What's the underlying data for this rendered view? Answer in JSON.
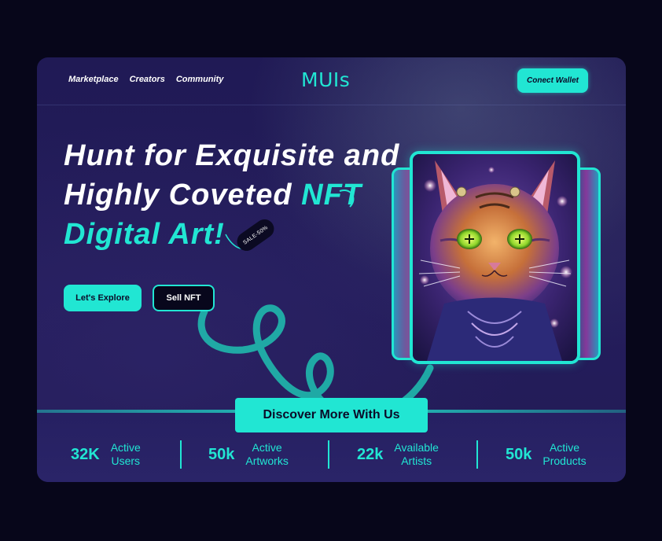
{
  "nav": {
    "links": [
      "Marketplace",
      "Creators",
      "Community"
    ],
    "logo": "MUIs",
    "wallet_button": "Conect Wallet"
  },
  "hero": {
    "headline_line1": "Hunt for Exquisite and",
    "headline_line2_white": "Highly Coveted ",
    "headline_line2_accent": "NFT",
    "headline_line3_accent": "Digital Art!",
    "sale_tag": "SALE-50%",
    "explore_button": "Let's Explore",
    "sell_button": "Sell NFT"
  },
  "artwork": {
    "subject": "neon-cat-artwork"
  },
  "discover_button": "Discover More With Us",
  "stats": [
    {
      "value": "32K",
      "label": "Active\nUsers"
    },
    {
      "value": "50k",
      "label": "Active\nArtworks"
    },
    {
      "value": "22k",
      "label": "Available\nArtists"
    },
    {
      "value": "50k",
      "label": "Active\nProducts"
    }
  ],
  "colors": {
    "accent": "#21e6d3",
    "background": "#07061a",
    "card": "#221b56"
  }
}
